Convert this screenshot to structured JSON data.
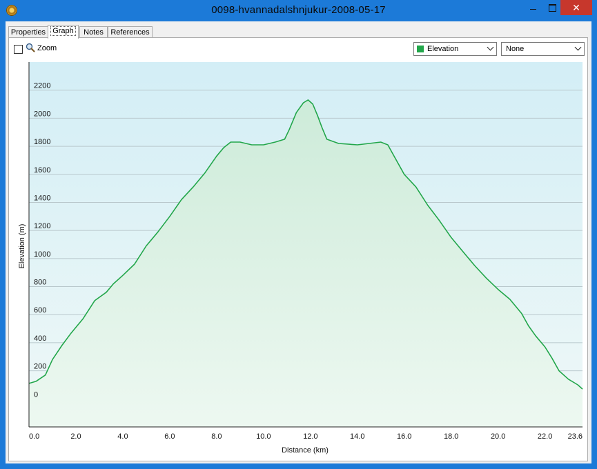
{
  "window": {
    "title": "0098-hvannadalshnjukur-2008-05-17",
    "minimize_glyph": "",
    "close_glyph": "✕"
  },
  "tabs": [
    {
      "label": "Properties"
    },
    {
      "label": "Graph"
    },
    {
      "label": "Notes"
    },
    {
      "label": "References"
    }
  ],
  "toolbar": {
    "zoom_label": "Zoom",
    "zoom_checked": false,
    "series_select": "Elevation",
    "series_color": "#22a64a",
    "secondary_select": "None"
  },
  "chart_data": {
    "type": "area",
    "xlabel": "Distance  (km)",
    "ylabel": "Elevation (m)",
    "xlim": [
      0,
      23.6
    ],
    "ylim": [
      -200,
      2400
    ],
    "x_ticks": [
      "0.0",
      "2.0",
      "4.0",
      "6.0",
      "8.0",
      "10.0",
      "12.0",
      "14.0",
      "16.0",
      "18.0",
      "20.0",
      "22.0",
      "23.6"
    ],
    "y_ticks": [
      "0",
      "200",
      "400",
      "600",
      "800",
      "1000",
      "1200",
      "1400",
      "1600",
      "1800",
      "2000",
      "2200"
    ],
    "grid": true,
    "series": [
      {
        "name": "Elevation",
        "color": "#22a64a",
        "x": [
          0.0,
          0.3,
          0.7,
          1.0,
          1.4,
          1.8,
          2.3,
          2.8,
          3.3,
          3.6,
          4.0,
          4.5,
          5.0,
          5.5,
          6.0,
          6.5,
          7.0,
          7.5,
          8.0,
          8.3,
          8.6,
          9.0,
          9.5,
          10.0,
          10.5,
          10.9,
          11.1,
          11.4,
          11.7,
          11.9,
          12.1,
          12.3,
          12.5,
          12.7,
          13.2,
          14.0,
          14.5,
          15.0,
          15.3,
          15.6,
          16.0,
          16.5,
          17.0,
          17.5,
          18.0,
          18.5,
          19.0,
          19.5,
          20.0,
          20.5,
          21.0,
          21.3,
          21.6,
          22.0,
          22.3,
          22.6,
          23.0,
          23.4,
          23.6
        ],
        "values": [
          110,
          125,
          170,
          280,
          380,
          470,
          570,
          700,
          760,
          820,
          880,
          960,
          1090,
          1190,
          1300,
          1420,
          1510,
          1610,
          1730,
          1790,
          1830,
          1830,
          1810,
          1810,
          1830,
          1850,
          1920,
          2040,
          2110,
          2130,
          2100,
          2020,
          1930,
          1850,
          1820,
          1810,
          1820,
          1830,
          1810,
          1720,
          1600,
          1510,
          1380,
          1270,
          1150,
          1050,
          950,
          860,
          780,
          710,
          610,
          520,
          450,
          370,
          290,
          200,
          140,
          100,
          70
        ]
      }
    ]
  }
}
